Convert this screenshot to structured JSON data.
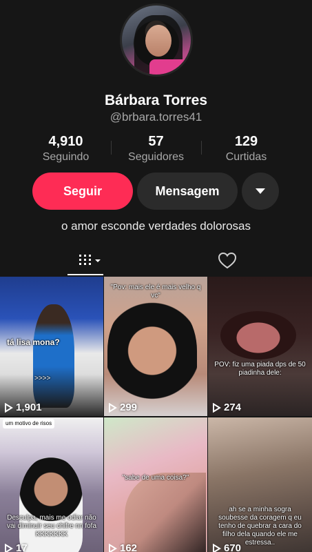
{
  "profile": {
    "name": "Bárbara Torres",
    "handle": "@brbara.torres41",
    "bio": "o amor esconde verdades dolorosas"
  },
  "stats": [
    {
      "value": "4,910",
      "label": "Seguindo"
    },
    {
      "value": "57",
      "label": "Seguidores"
    },
    {
      "value": "129",
      "label": "Curtidas"
    }
  ],
  "actions": {
    "follow": "Seguir",
    "message": "Mensagem"
  },
  "colors": {
    "accent": "#fe2c55",
    "background": "#161616"
  },
  "videos": [
    {
      "views": "1,901",
      "caption": "tá lisa mona?"
    },
    {
      "views": "299",
      "caption": "\"Pov: mais ele é mais velho q vc\""
    },
    {
      "views": "274",
      "caption": "POV: fiz uma piada dps de 50 piadinha dele:"
    },
    {
      "views": "17",
      "caption": "Desculpa, mais me odiar não vai diminuir seu chifre nn fofa KKKKKKK"
    },
    {
      "views": "162",
      "caption": "\"sabe de uma coisa?\""
    },
    {
      "views": "670",
      "caption": "ah se a minha sogra soubesse da coragem q eu tenho de quebrar a cara do filho dela quando ele me estressa.."
    }
  ],
  "extra_text": {
    "c1_arrows": ">>>>",
    "c4_top": "um motivo de risos"
  }
}
